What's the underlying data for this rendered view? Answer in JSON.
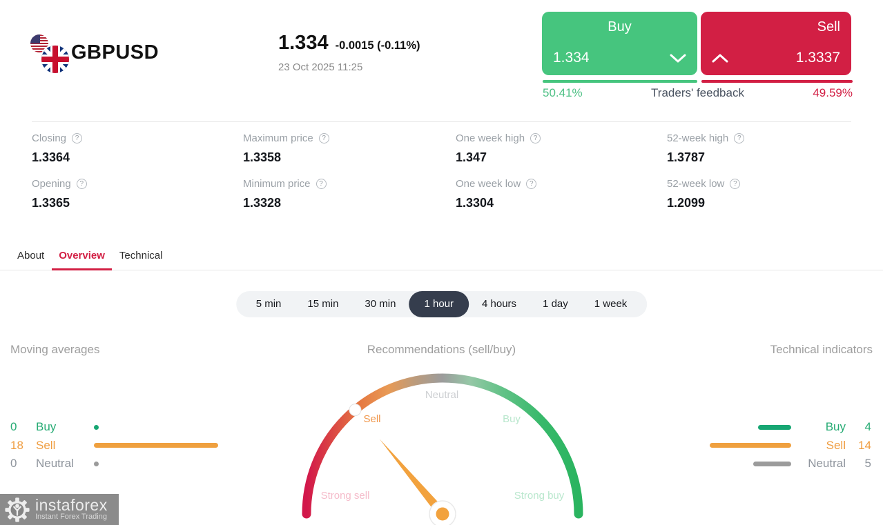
{
  "header": {
    "symbol": "GBPUSD",
    "price": "1.334",
    "change": "-0.0015 (-0.11%)",
    "datetime": "23 Oct 2025 11:25",
    "buy": {
      "label": "Buy",
      "price": "1.334"
    },
    "sell": {
      "label": "Sell",
      "price": "1.3337"
    },
    "feedback": {
      "buy_pct": "50.41%",
      "label": "Traders' feedback",
      "sell_pct": "49.59%"
    }
  },
  "stats": [
    {
      "label": "Closing",
      "value": "1.3364"
    },
    {
      "label": "Maximum price",
      "value": "1.3358"
    },
    {
      "label": "One week high",
      "value": "1.347"
    },
    {
      "label": "52-week high",
      "value": "1.3787"
    },
    {
      "label": "Opening",
      "value": "1.3365"
    },
    {
      "label": "Minimum price",
      "value": "1.3328"
    },
    {
      "label": "One week low",
      "value": "1.3304"
    },
    {
      "label": "52-week low",
      "value": "1.2099"
    }
  ],
  "tabs": [
    {
      "label": "About",
      "active": false
    },
    {
      "label": "Overview",
      "active": true
    },
    {
      "label": "Technical",
      "active": false
    }
  ],
  "timeframes": [
    {
      "label": "5 min",
      "active": false
    },
    {
      "label": "15 min",
      "active": false
    },
    {
      "label": "30 min",
      "active": false
    },
    {
      "label": "1 hour",
      "active": true
    },
    {
      "label": "4 hours",
      "active": false
    },
    {
      "label": "1 day",
      "active": false
    },
    {
      "label": "1 week",
      "active": false
    }
  ],
  "sections": {
    "left": "Moving averages",
    "center": "Recommendations (sell/buy)",
    "right": "Technical indicators"
  },
  "gauge": {
    "labels": {
      "strong_sell": "Strong sell",
      "sell": "Sell",
      "neutral": "Neutral",
      "buy": "Buy",
      "strong_buy": "Strong buy"
    },
    "needle_angle_deg": 130,
    "marker_angle_deg": 130
  },
  "moving_averages": {
    "rows": [
      {
        "count": 0,
        "label": "Buy"
      },
      {
        "count": 18,
        "label": "Sell"
      },
      {
        "count": 0,
        "label": "Neutral"
      }
    ]
  },
  "technical_indicators": {
    "rows": [
      {
        "label": "Buy",
        "count": 4
      },
      {
        "label": "Sell",
        "count": 14
      },
      {
        "label": "Neutral",
        "count": 5
      }
    ]
  },
  "watermark": {
    "brand": "instaforex",
    "tagline": "Instant Forex Trading"
  },
  "colors": {
    "buy_green": "#46c57e",
    "sell_red": "#d21f44",
    "orange": "#efa03f",
    "legend_green": "#17a673",
    "active_pill": "#353d4d"
  }
}
